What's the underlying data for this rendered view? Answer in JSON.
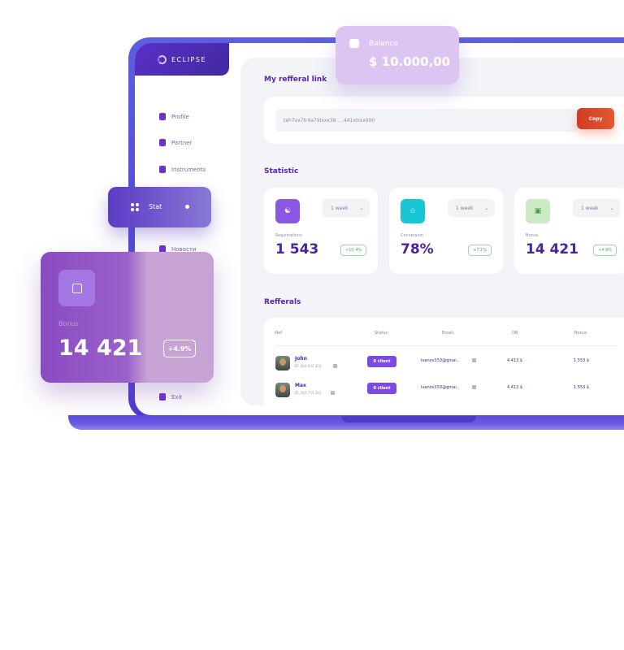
{
  "brand": {
    "name": "ECLIPSE"
  },
  "sidebar": {
    "items": [
      {
        "label": "Profile",
        "icon": "user-icon"
      },
      {
        "label": "Partner",
        "icon": "briefcase-icon"
      },
      {
        "label": "Instruments",
        "icon": "toolbox-icon"
      },
      {
        "label": "Новости",
        "icon": "bell-icon"
      },
      {
        "label": "Exit",
        "icon": "exit-icon"
      }
    ]
  },
  "referral": {
    "title": "My refferal link",
    "link": "teh7xx7tr4a79lxxx38.....441xtrxx000",
    "copy_label": "Copy"
  },
  "statistic": {
    "title": "Statistic",
    "cards": [
      {
        "label": "Registrations",
        "value": "1 543",
        "change": "+10.4%",
        "period": "1 week",
        "icon": "users-icon",
        "color": "#8a57e3"
      },
      {
        "label": "Conversion",
        "value": "78%",
        "change": "+7.1%",
        "period": "1 week",
        "icon": "star-icon",
        "color": "#18c6d8"
      },
      {
        "label": "Bonus",
        "value": "14 421",
        "change": "+4.9%",
        "period": "1 week",
        "icon": "gift-icon",
        "color": "#c9eac3"
      }
    ]
  },
  "referrals": {
    "title": "Refferals",
    "columns": [
      "Ref",
      "Status",
      "Email",
      "OB",
      "Bonus"
    ],
    "rows": [
      {
        "name": "John",
        "id": "ID: 004 043 403",
        "status": "0 client",
        "email": "Ivanov153@gmai..",
        "ob": "4 413 $",
        "bonus": "1 553 $"
      },
      {
        "name": "Max",
        "id": "ID: 002 753 341",
        "status": "0 client",
        "email": "Ivanov153@gmai..",
        "ob": "4 413 $",
        "bonus": "1 553 $"
      }
    ]
  },
  "balance": {
    "label": "Balance",
    "value": "$ 10.000,00"
  },
  "stat_pill": {
    "label": "Stat"
  },
  "bonus_card": {
    "label": "Bonus",
    "value": "14 421",
    "change": "+4.9%"
  }
}
